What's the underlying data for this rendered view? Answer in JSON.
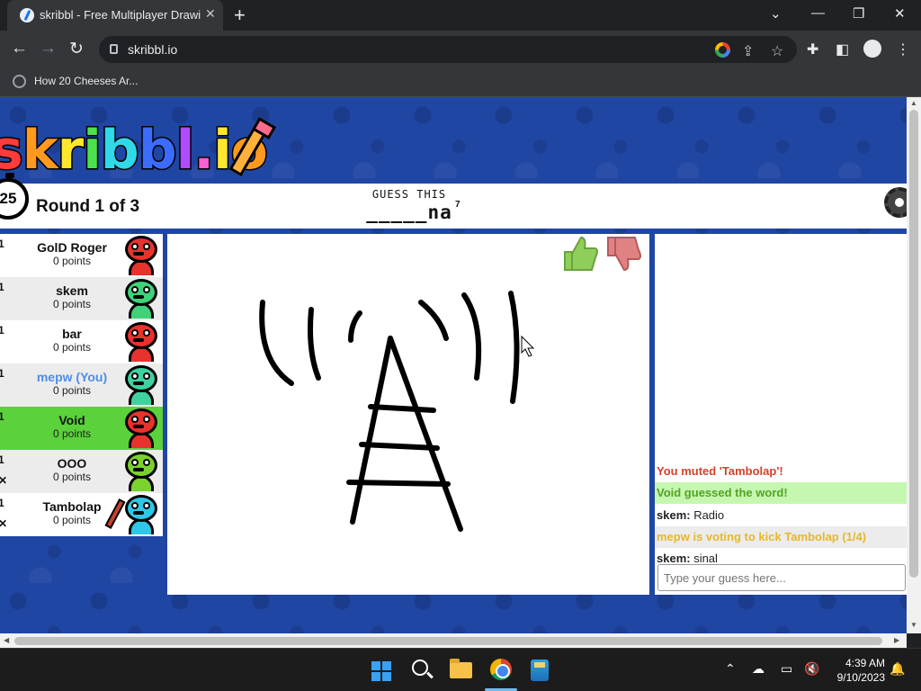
{
  "browser": {
    "tab_title": "skribbl - Free Multiplayer Drawing & Guessing Game",
    "tab_close": "✕",
    "new_tab": "+",
    "url": "skribbl.io",
    "bookmark": "How 20 Cheeses Ar..."
  },
  "game": {
    "logo_letters": [
      {
        "ch": "s",
        "color": "#ff3b3b"
      },
      {
        "ch": "k",
        "color": "#ff9a1f"
      },
      {
        "ch": "r",
        "color": "#ffe72e"
      },
      {
        "ch": "i",
        "color": "#4be34b"
      },
      {
        "ch": "b",
        "color": "#2fd9e8"
      },
      {
        "ch": "b",
        "color": "#3b6cff"
      },
      {
        "ch": "l",
        "color": "#b04bff"
      },
      {
        "ch": ".",
        "color": "#ff5fd2"
      },
      {
        "ch": "i",
        "color": "#ffe72e"
      },
      {
        "ch": "o",
        "color": "#ff9a1f"
      }
    ],
    "timer": "25",
    "round": "Round 1 of 3",
    "guess_label": "GUESS THIS",
    "guess_word": "_____na",
    "word_length": "7"
  },
  "players": [
    {
      "rank": "1",
      "name": "GolD Roger",
      "points": "0 points",
      "color": "#e8322e",
      "me": false,
      "guessed": false,
      "kicked": false,
      "drawing": false
    },
    {
      "rank": "1",
      "name": "skem",
      "points": "0 points",
      "color": "#3fd27a",
      "me": false,
      "guessed": false,
      "kicked": false,
      "drawing": false
    },
    {
      "rank": "1",
      "name": "bar",
      "points": "0 points",
      "color": "#e8322e",
      "me": false,
      "guessed": false,
      "kicked": false,
      "drawing": false
    },
    {
      "rank": "1",
      "name": "mepw (You)",
      "points": "0 points",
      "color": "#3fd2a0",
      "me": true,
      "guessed": false,
      "kicked": false,
      "drawing": false
    },
    {
      "rank": "1",
      "name": "Void",
      "points": "0 points",
      "color": "#e8322e",
      "me": false,
      "guessed": true,
      "kicked": false,
      "drawing": false
    },
    {
      "rank": "1",
      "name": "OOO",
      "points": "0 points",
      "color": "#7bd12e",
      "me": false,
      "guessed": false,
      "kicked": true,
      "drawing": false
    },
    {
      "rank": "1",
      "name": "Tambolap",
      "points": "0 points",
      "color": "#2fc7e8",
      "me": false,
      "guessed": false,
      "kicked": true,
      "drawing": true
    }
  ],
  "chat": {
    "messages": [
      {
        "author": "",
        "text": "You muted 'Tambolap'!",
        "color": "#d6412b",
        "bg": "#ffffff",
        "bold": true
      },
      {
        "author": "",
        "text": "Void guessed the word!",
        "color": "#53a324",
        "bg": "#c6f7b0",
        "bold": true
      },
      {
        "author": "skem:",
        "text": " Radio",
        "color": "#222222",
        "bg": "#ffffff",
        "bold": false
      },
      {
        "author": "",
        "text": "mepw is voting to kick Tambolap (1/4)",
        "color": "#e6b82a",
        "bg": "#ececec",
        "bold": true
      },
      {
        "author": "skem:",
        "text": " sinal",
        "color": "#222222",
        "bg": "#ffffff",
        "bold": false
      }
    ],
    "input_placeholder": "Type your guess here..."
  },
  "taskbar": {
    "time": "4:39 AM",
    "date": "9/10/2023"
  }
}
